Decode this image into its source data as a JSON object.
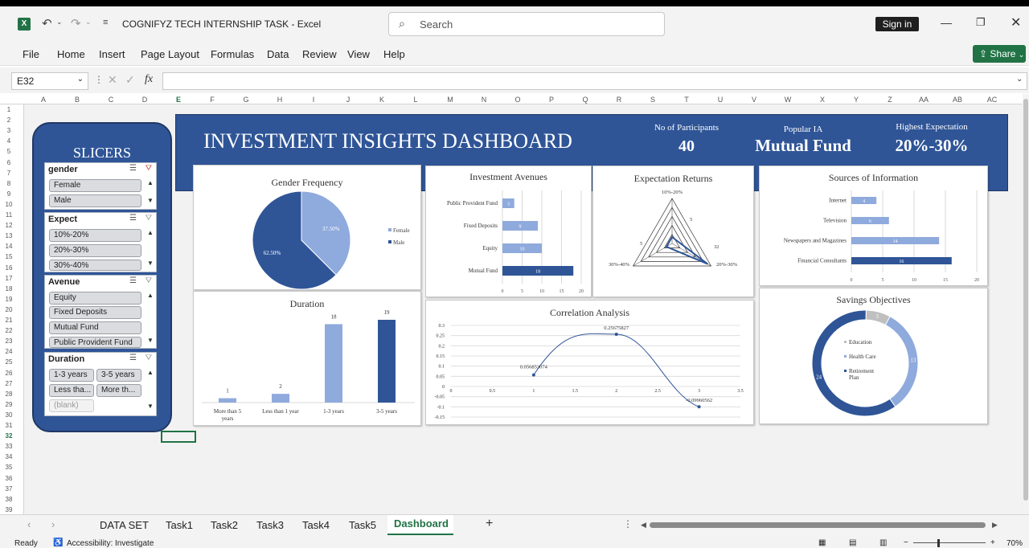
{
  "app": {
    "doc_title": "COGNIFYZ TECH INTERNSHIP TASK  -  Excel",
    "search_placeholder": "Search",
    "sign_in": "Sign in",
    "share": "Share"
  },
  "menu": [
    "File",
    "Home",
    "Insert",
    "Page Layout",
    "Formulas",
    "Data",
    "Review",
    "View",
    "Help"
  ],
  "formula_bar": {
    "cell_ref": "E32",
    "fx": "fx",
    "value": ""
  },
  "columns": [
    "A",
    "B",
    "C",
    "D",
    "E",
    "F",
    "G",
    "H",
    "I",
    "J",
    "K",
    "L",
    "M",
    "N",
    "O",
    "P",
    "Q",
    "R",
    "S",
    "T",
    "U",
    "V",
    "W",
    "X",
    "Y",
    "Z",
    "AA",
    "AB",
    "AC"
  ],
  "rows": [
    "1",
    "2",
    "3",
    "4",
    "5",
    "6",
    "7",
    "8",
    "9",
    "10",
    "11",
    "12",
    "13",
    "14",
    "15",
    "16",
    "17",
    "18",
    "19",
    "20",
    "21",
    "22",
    "23",
    "24",
    "25",
    "26",
    "27",
    "28",
    "29",
    "30",
    "31",
    "32",
    "33",
    "34",
    "35",
    "36",
    "37",
    "38",
    "39"
  ],
  "sheet_tabs": [
    "DATA SET",
    "Task1",
    "Task2",
    "Task3",
    "Task4",
    "Task5",
    "Dashboard"
  ],
  "active_tab": "Dashboard",
  "status": {
    "ready": "Ready",
    "accessibility": "Accessibility: Investigate",
    "zoom": "70%"
  },
  "colors": {
    "accent": "#2f5597",
    "dark": "#203864",
    "light": "#8faadc",
    "excel_green": "#217346",
    "grey": "#bfbfbf"
  },
  "slicers": {
    "title": "SLICERS",
    "gender": {
      "title": "gender",
      "items": [
        "Female",
        "Male"
      ]
    },
    "expect": {
      "title": "Expect",
      "items": [
        "10%-20%",
        "20%-30%",
        "30%-40%"
      ]
    },
    "avenue": {
      "title": "Avenue",
      "items": [
        "Equity",
        "Fixed Deposits",
        "Mutual Fund",
        "Public Provident Fund"
      ]
    },
    "duration": {
      "title": "Duration",
      "items": [
        "1-3 years",
        "3-5 years",
        "Less tha...",
        "More th...",
        "(blank)"
      ]
    }
  },
  "banner": {
    "title": "INVESTMENT INSIGHTS DASHBOARD",
    "kpi1_label": "No of Participants",
    "kpi1_value": "40",
    "kpi2_label": "Popular IA",
    "kpi2_value": "Mutual Fund",
    "kpi3_label": "Highest Expectation",
    "kpi3_value": "20%-30%"
  },
  "chart_data": [
    {
      "type": "pie",
      "title": "Gender Frequency",
      "categories": [
        "Female",
        "Male"
      ],
      "values": [
        37.5,
        62.5
      ],
      "data_labels": [
        "37.50%",
        "62.50%"
      ],
      "legend": "right"
    },
    {
      "type": "bar",
      "orientation": "horizontal",
      "title": "Investment Avenues",
      "categories": [
        "Public Provident Fund",
        "Fixed Deposits",
        "Equity",
        "Mutual Fund"
      ],
      "values": [
        3,
        9,
        10,
        18
      ],
      "xlim": [
        0,
        20
      ],
      "ticks": [
        "0",
        "5",
        "10",
        "15",
        "20"
      ]
    },
    {
      "type": "radar",
      "title": "Expectation Returns",
      "categories": [
        "10%-20%",
        "20%-30%",
        "30%-40%"
      ],
      "values": [
        5,
        32,
        5
      ],
      "value_labels": [
        "5",
        "32",
        "5"
      ]
    },
    {
      "type": "bar",
      "orientation": "horizontal",
      "title": "Sources of Information",
      "categories": [
        "Internet",
        "Television",
        "Newspapers and Magazines",
        "Financial Consultants"
      ],
      "values": [
        4,
        6,
        14,
        16
      ],
      "xlim": [
        0,
        20
      ],
      "ticks": [
        "0",
        "5",
        "10",
        "15",
        "20"
      ]
    },
    {
      "type": "bar",
      "title": "Duration",
      "categories": [
        "More than 5 years",
        "Less than 1 year",
        "1-3 years",
        "3-5 years"
      ],
      "values": [
        1,
        2,
        18,
        19
      ]
    },
    {
      "type": "line",
      "title": "Correlation Analysis",
      "x": [
        1,
        2,
        3
      ],
      "y": [
        0.056853074,
        0.25675827,
        -0.09960562
      ],
      "labels": [
        "0.056853074",
        "0.25675827",
        "-0.09960562"
      ],
      "ylim": [
        -0.15,
        0.3
      ],
      "yticks": [
        "0.3",
        "0.25",
        "0.2",
        "0.15",
        "0.1",
        "0.05",
        "0",
        "-0.05",
        "-0.1",
        "-0.15"
      ],
      "xticks": [
        "0",
        "0.5",
        "1",
        "1.5",
        "2",
        "2.5",
        "3",
        "3.5"
      ]
    },
    {
      "type": "donut",
      "title": "Savings Objectives",
      "categories": [
        "Education",
        "Health Care",
        "Retirement Plan"
      ],
      "values": [
        3,
        13,
        24
      ],
      "legend_labels": [
        "Education",
        "Health Care",
        "Retirement\nPlan"
      ]
    }
  ]
}
